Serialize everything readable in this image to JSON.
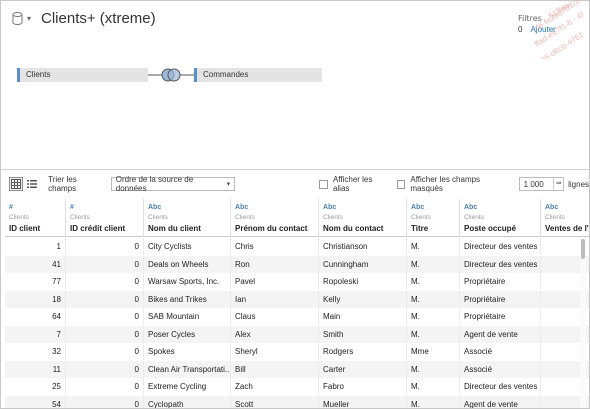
{
  "header": {
    "title": "Clients+ (xtreme)",
    "filters_label": "Filtres",
    "filters_count": "0",
    "filters_add": "Ajouter"
  },
  "watermark_lines": [
    "51Baa7",
    "d6 fa2bd701c6 b",
    "ffad-ee7f1-8 - 4f",
    "96-d6cb-4761"
  ],
  "relationship": {
    "left_table": "Clients",
    "right_table": "Commandes"
  },
  "toolbar": {
    "sort_label": "Trier les champs",
    "sort_value": "Ordre de la source de données",
    "show_aliases": "Afficher les alias",
    "show_hidden": "Afficher les champs masqués",
    "rows_value": "1 000",
    "rows_label": "lignes"
  },
  "columns": [
    {
      "type": "#",
      "source": "Clients",
      "name": "ID client"
    },
    {
      "type": "#",
      "source": "Clients",
      "name": "ID crédit client"
    },
    {
      "type": "Abc",
      "source": "Clients",
      "name": "Nom du client"
    },
    {
      "type": "Abc",
      "source": "Clients",
      "name": "Prénom du contact"
    },
    {
      "type": "Abc",
      "source": "Clients",
      "name": "Nom du contact"
    },
    {
      "type": "Abc",
      "source": "Clients",
      "name": "Titre"
    },
    {
      "type": "Abc",
      "source": "Clients",
      "name": "Poste occupé"
    },
    {
      "type": "Abc",
      "source": "Clients",
      "name": "Ventes de l'an"
    }
  ],
  "rows": [
    [
      "1",
      "0",
      "City Cyclists",
      "Chris",
      "Christianson",
      "M.",
      "Directeur des ventes"
    ],
    [
      "41",
      "0",
      "Deals on Wheels",
      "Ron",
      "Cunningham",
      "M.",
      "Directeur des ventes"
    ],
    [
      "77",
      "0",
      "Warsaw Sports, Inc.",
      "Pavel",
      "Ropoleski",
      "M.",
      "Propriétaire"
    ],
    [
      "18",
      "0",
      "Bikes and Trikes",
      "Ian",
      "Kelly",
      "M.",
      "Propriétaire"
    ],
    [
      "64",
      "0",
      "SAB Mountain",
      "Claus",
      "Main",
      "M.",
      "Propriétaire"
    ],
    [
      "7",
      "0",
      "Poser Cycles",
      "Alex",
      "Smith",
      "M.",
      "Agent de vente"
    ],
    [
      "32",
      "0",
      "Spokes",
      "Sheryl",
      "Rodgers",
      "Mme",
      "Associé"
    ],
    [
      "11",
      "0",
      "Clean Air Transportati...",
      "Bill",
      "Carter",
      "M.",
      "Associé"
    ],
    [
      "25",
      "0",
      "Extreme Cycling",
      "Zach",
      "Fabro",
      "M.",
      "Directeur des ventes"
    ],
    [
      "54",
      "0",
      "Cyclopath",
      "Scott",
      "Mueller",
      "M.",
      "Agent de vente"
    ]
  ]
}
